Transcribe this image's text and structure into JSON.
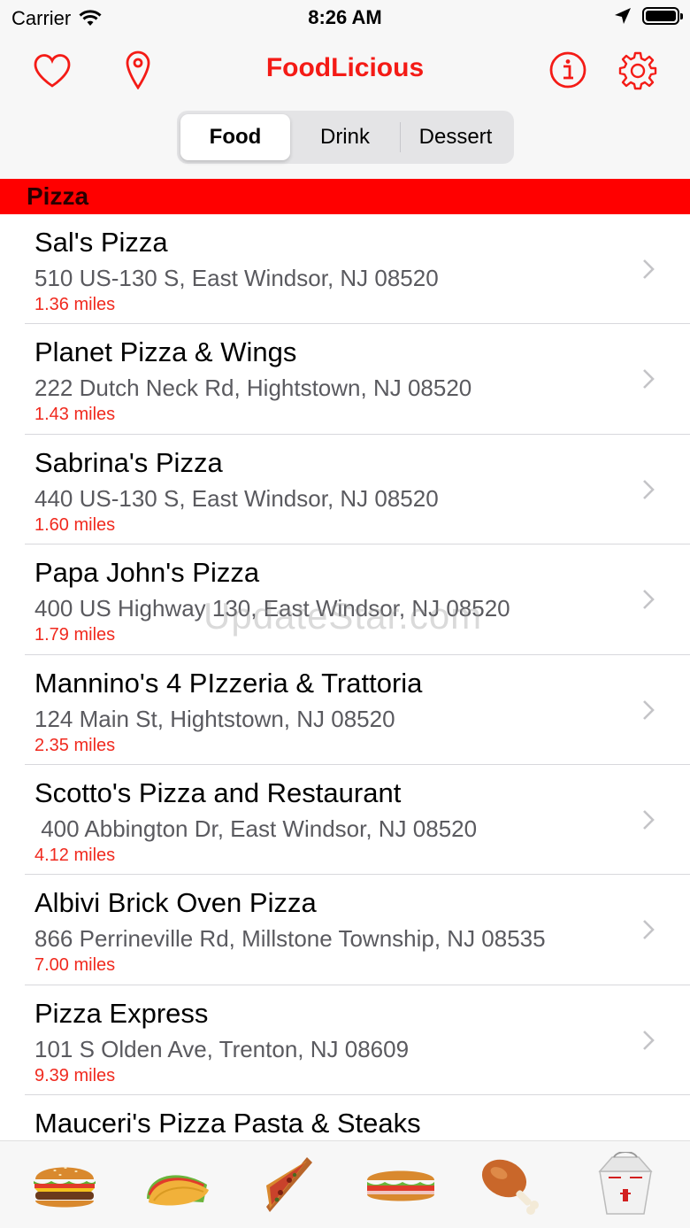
{
  "status_bar": {
    "carrier": "Carrier",
    "time": "8:26 AM"
  },
  "header": {
    "title": "FoodLicious"
  },
  "segments": [
    "Food",
    "Drink",
    "Dessert"
  ],
  "selected_segment": "Food",
  "section": {
    "title": "Pizza"
  },
  "restaurants": [
    {
      "name": "Sal's Pizza",
      "address": "510 US-130 S, East Windsor, NJ 08520",
      "distance": "1.36 miles"
    },
    {
      "name": "Planet Pizza & Wings",
      "address": "222 Dutch Neck Rd, Hightstown, NJ 08520",
      "distance": "1.43 miles"
    },
    {
      "name": "Sabrina's Pizza",
      "address": "440 US-130 S, East Windsor, NJ 08520",
      "distance": "1.60 miles"
    },
    {
      "name": "Papa John's Pizza",
      "address": "400 US Highway 130, East Windsor, NJ 08520",
      "distance": "1.79 miles"
    },
    {
      "name": "Mannino's 4 PIzzeria & Trattoria",
      "address": "124 Main St, Hightstown, NJ 08520",
      "distance": "2.35 miles"
    },
    {
      "name": "Scotto's Pizza and Restaurant",
      "address": " 400 Abbington Dr, East Windsor, NJ 08520",
      "distance": "4.12 miles"
    },
    {
      "name": "Albivi Brick Oven Pizza",
      "address": "866 Perrineville Rd, Millstone Township, NJ 08535",
      "distance": "7.00 miles"
    },
    {
      "name": "Pizza Express",
      "address": "101 S Olden Ave, Trenton, NJ 08609",
      "distance": "9.39 miles"
    },
    {
      "name": "Mauceri's Pizza Pasta & Steaks",
      "address": "",
      "distance": ""
    }
  ],
  "watermark": "UpdateStar.com",
  "tab_bar": {
    "tabs": [
      "burger-icon",
      "taco-icon",
      "pizza-slice-icon",
      "sub-sandwich-icon",
      "chicken-leg-icon",
      "takeout-box-icon"
    ]
  },
  "colors": {
    "accent": "#f41b16",
    "section_header": "#ff0000",
    "distance": "#f02a1f"
  }
}
